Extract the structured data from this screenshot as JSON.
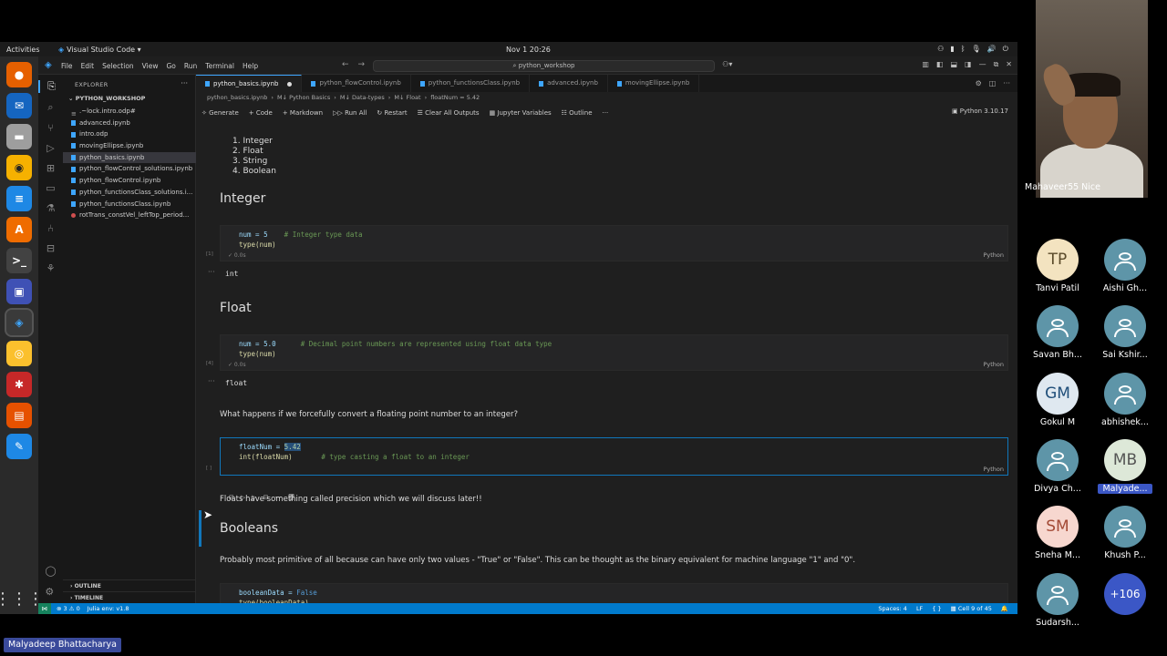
{
  "gnome": {
    "activities": "Activities",
    "app_name": "Visual Studio Code ▾",
    "clock": "Nov 1  20:26"
  },
  "vscode": {
    "menu": [
      "File",
      "Edit",
      "Selection",
      "View",
      "Go",
      "Run",
      "Terminal",
      "Help"
    ],
    "search": "python_workshop",
    "explorer": {
      "header": "EXPLORER",
      "workspace": "PYTHON_WORKSHOP",
      "files": [
        ".~lock.intro.odp#",
        "advanced.ipynb",
        "intro.odp",
        "movingEllipse.ipynb",
        "python_basics.ipynb",
        "python_flowControl_solutions.ipynb",
        "python_flowControl.ipynb",
        "python_functionsClass_solutions.i...",
        "python_functionsClass.ipynb",
        "rotTrans_constVel_leftTop_period..."
      ],
      "outline": "OUTLINE",
      "timeline": "TIMELINE"
    },
    "tabs": [
      "python_basics.ipynb",
      "python_flowControl.ipynb",
      "python_functionsClass.ipynb",
      "advanced.ipynb",
      "movingEllipse.ipynb"
    ],
    "breadcrumb": [
      "python_basics.ipynb",
      "M↓ Python Basics",
      "M↓ Data-types",
      "M↓ Float",
      "floatNum = 5.42"
    ],
    "toolbar": [
      "Generate",
      "+ Code",
      "+ Markdown",
      "Run All",
      "Restart",
      "Clear All Outputs",
      "Jupyter Variables",
      "Outline"
    ],
    "kernel": "Python 3.10.17",
    "notebook": {
      "list": [
        "1. Integer",
        "2. Float",
        "3. String",
        "4. Boolean"
      ],
      "h_integer": "Integer",
      "cell1": {
        "l1_a": "num = 5",
        "l1_b": "# Integer type data",
        "l2": "type(num)",
        "status": "✓  0.0s",
        "exec": "[1]",
        "output": "int"
      },
      "h_float": "Float",
      "cell2": {
        "l1_a": "num = 5.0",
        "l1_b": "# Decimal point numbers are represented using float data type",
        "l2": "type(num)",
        "status": "✓  0.0s",
        "exec": "[4]",
        "output": "float"
      },
      "question": "What happens if we forcefully convert a floating point number to an integer?",
      "cell3": {
        "l1_a": "floatNum = ",
        "l1_b": "5.42",
        "l2_a": "int(floatNum)",
        "l2_b": "# type casting a float to an integer",
        "exec": "[ ]"
      },
      "precision": "Floats have something called precision which we will discuss later!!",
      "h_bool": "Booleans",
      "bool_text": "Probably most primitive of all because can have only two values - \"True\" or \"False\". This can be thought as the binary equivalent for machine language \"1\" and \"0\".",
      "cell4": {
        "l1_a": "booleanData = ",
        "l1_b": "False",
        "l2": "type(booleanData)"
      },
      "lang": "Python"
    },
    "status": {
      "problems": "⊗ 3 ⚠ 0",
      "julia": "Julia env: v1.8",
      "spaces": "Spaces: 4",
      "eol": "LF",
      "braces": "{ }",
      "cell": "Cell 9 of 45"
    }
  },
  "meeting": {
    "self_name": "Mahaveer55 Nice",
    "participants": [
      {
        "initials": "TP",
        "name": "Tanvi Patil",
        "color": "#f3e3c0",
        "text": "#5a4a2a"
      },
      {
        "initials": "",
        "name": "Aishi Gh..."
      },
      {
        "initials": "",
        "name": "Savan Bh..."
      },
      {
        "initials": "",
        "name": "Sai Kshir..."
      },
      {
        "initials": "GM",
        "name": "Gokul M",
        "color": "#dfe8f0",
        "text": "#1f4e79"
      },
      {
        "initials": "",
        "name": "abhishek..."
      },
      {
        "initials": "",
        "name": "Divya Ch..."
      },
      {
        "initials": "MB",
        "name": "Malyade...",
        "color": "#dde8d8",
        "text": "#555"
      },
      {
        "initials": "SM",
        "name": "Sneha M...",
        "color": "#f7d7cf",
        "text": "#a34a36"
      },
      {
        "initials": "",
        "name": "Khush P..."
      },
      {
        "initials": "",
        "name": "Sudarsh..."
      },
      {
        "initials": "+106",
        "name": "",
        "color": "#3b57c6",
        "text": "#ffffff"
      }
    ],
    "presenter": "Malyadeep Bhattacharya"
  }
}
